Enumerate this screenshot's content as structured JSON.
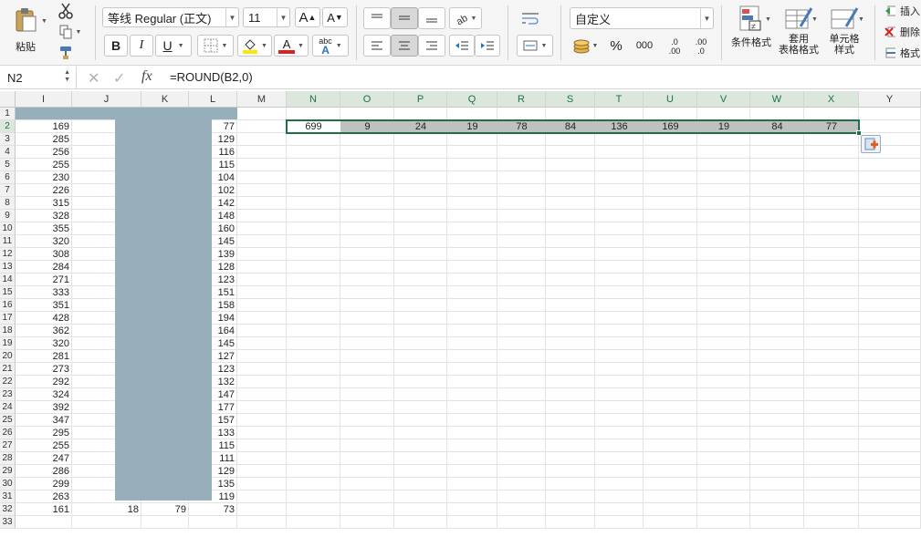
{
  "ribbon": {
    "font_name": "等线 Regular (正文)",
    "font_size": "11",
    "grow_font": "A",
    "shrink_font": "A",
    "paste_label": "粘贴",
    "bold": "B",
    "italic": "I",
    "underline": "U",
    "font_color_glyph": "A",
    "phonetic_top": "abc",
    "phonetic_bottom": "A",
    "number_format": "自定义",
    "percent": "%",
    "comma": "000",
    "inc_decimal_top": ".0",
    "inc_decimal_bottom": ".00",
    "dec_decimal_top": ".00",
    "dec_decimal_bottom": ".0",
    "cond_format_label": "条件格式",
    "table_format_label_1": "套用",
    "table_format_label_2": "表格格式",
    "cell_style_label_1": "单元格",
    "cell_style_label_2": "样式",
    "insert_label": "插入",
    "delete_label": "删除",
    "format_label": "格式",
    "colors": {
      "accent_green": "#1e7145",
      "font_red": "#e02020",
      "fill_yellow": "#ffe600"
    }
  },
  "formula_bar": {
    "name_box": "N2",
    "fx": "fx",
    "formula": "=ROUND(B2,0)"
  },
  "sheet": {
    "columns": [
      "I",
      "J",
      "K",
      "L",
      "M",
      "N",
      "O",
      "P",
      "Q",
      "R",
      "S",
      "T",
      "U",
      "V",
      "W",
      "X",
      "Y"
    ],
    "selected_columns": [
      "N",
      "O",
      "P",
      "Q",
      "R",
      "S",
      "T",
      "U",
      "V",
      "W",
      "X"
    ],
    "rows": [
      "1",
      "2",
      "3",
      "4",
      "5",
      "6",
      "7",
      "8",
      "9",
      "10",
      "11",
      "12",
      "13",
      "14",
      "15",
      "16",
      "17",
      "18",
      "19",
      "20",
      "21",
      "22",
      "23",
      "24",
      "25",
      "26",
      "27",
      "28",
      "29",
      "30",
      "31",
      "32",
      "33"
    ],
    "selected_row": "2",
    "col_I_values": [
      "169",
      "285",
      "256",
      "255",
      "230",
      "226",
      "315",
      "328",
      "355",
      "320",
      "308",
      "284",
      "271",
      "333",
      "351",
      "428",
      "362",
      "320",
      "281",
      "273",
      "292",
      "324",
      "392",
      "347",
      "295",
      "255",
      "247",
      "286",
      "299",
      "263",
      "161"
    ],
    "col_L_values": [
      "77",
      "129",
      "116",
      "115",
      "104",
      "102",
      "142",
      "148",
      "160",
      "145",
      "139",
      "128",
      "123",
      "151",
      "158",
      "194",
      "164",
      "145",
      "127",
      "123",
      "132",
      "147",
      "177",
      "157",
      "133",
      "115",
      "111",
      "129",
      "135",
      "119",
      "73"
    ],
    "row32_J": "18",
    "row32_K": "79",
    "row2_selection": [
      "699",
      "9",
      "24",
      "19",
      "78",
      "84",
      "136",
      "169",
      "19",
      "84",
      "77"
    ],
    "active_cell": "N2",
    "selection_fill": "#c0c0c0",
    "mask_color": "#97afbb",
    "paste_options_icon": "paste-options-icon"
  }
}
